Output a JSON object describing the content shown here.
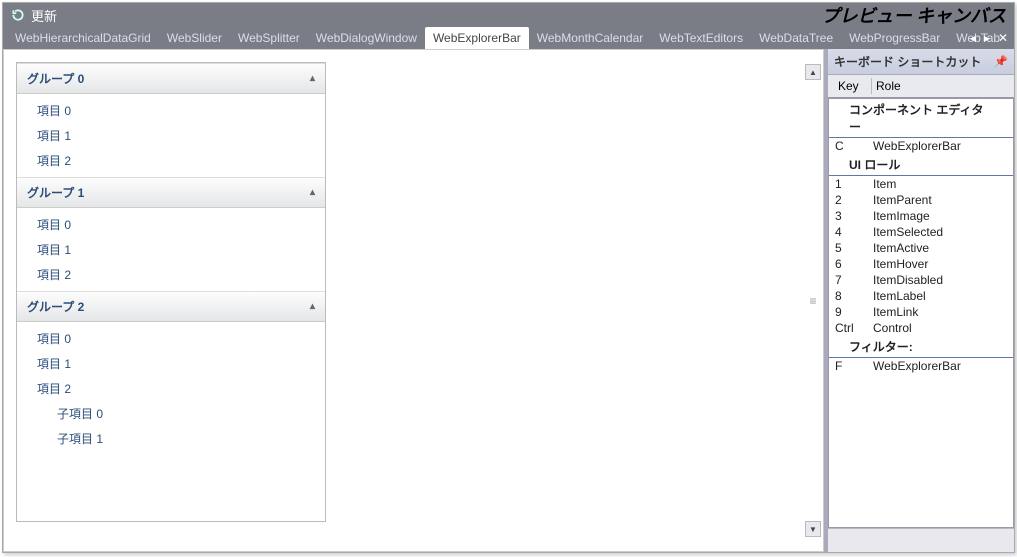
{
  "titlebar": {
    "refresh_label": "更新"
  },
  "preview_label": "プレビュー キャンバス",
  "tabs": {
    "items": [
      "WebHierarchicalDataGrid",
      "WebSlider",
      "WebSplitter",
      "WebDialogWindow",
      "WebExplorerBar",
      "WebMonthCalendar",
      "WebTextEditors",
      "WebDataTree",
      "WebProgressBar",
      "WebTab"
    ],
    "active_index": 4,
    "nav_left": "◂",
    "nav_right": "▸",
    "close": "✕"
  },
  "explorer": {
    "groups": [
      {
        "label": "グループ 0",
        "caret": "▴",
        "items": [
          {
            "label": "項目 0"
          },
          {
            "label": "項目 1"
          },
          {
            "label": "項目 2"
          }
        ]
      },
      {
        "label": "グループ 1",
        "caret": "▴",
        "items": [
          {
            "label": "項目 0"
          },
          {
            "label": "項目 1"
          },
          {
            "label": "項目 2"
          }
        ]
      },
      {
        "label": "グループ 2",
        "caret": "▴",
        "items": [
          {
            "label": "項目 0"
          },
          {
            "label": "項目 1"
          },
          {
            "label": "項目 2"
          },
          {
            "label": "子項目 0",
            "sub": true
          },
          {
            "label": "子項目 1",
            "sub": true
          }
        ]
      }
    ]
  },
  "side": {
    "header": "キーボード ショートカット",
    "pin_glyph": "📌",
    "col_key": "Key",
    "col_role": "Role",
    "sections": [
      {
        "title": "コンポーネント エディター",
        "rows": [
          {
            "k": "C",
            "v": "WebExplorerBar"
          }
        ]
      },
      {
        "title": "UI ロール",
        "rows": [
          {
            "k": "1",
            "v": "Item"
          },
          {
            "k": "2",
            "v": "ItemParent"
          },
          {
            "k": "3",
            "v": "ItemImage"
          },
          {
            "k": "4",
            "v": "ItemSelected"
          },
          {
            "k": "5",
            "v": "ItemActive"
          },
          {
            "k": "6",
            "v": "ItemHover"
          },
          {
            "k": "7",
            "v": "ItemDisabled"
          },
          {
            "k": "8",
            "v": "ItemLabel"
          },
          {
            "k": "9",
            "v": "ItemLink"
          },
          {
            "k": "Ctrl",
            "v": "Control"
          }
        ]
      },
      {
        "title": "フィルター:",
        "rows": [
          {
            "k": "F",
            "v": "WebExplorerBar"
          }
        ]
      }
    ]
  },
  "scroll": {
    "up": "▲",
    "down": "▼",
    "grip": "≡"
  }
}
